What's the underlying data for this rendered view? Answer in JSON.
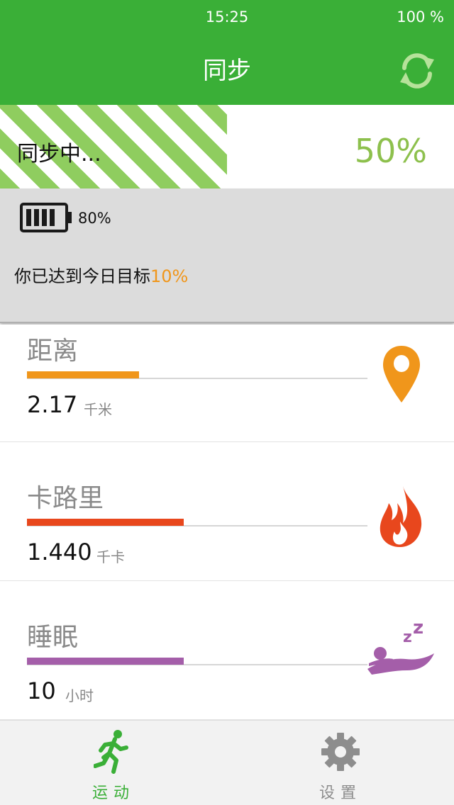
{
  "status_bar": {
    "time": "15:25",
    "battery": "100 %"
  },
  "header": {
    "title": "同步",
    "sync_icon": "sync-icon"
  },
  "sync_progress": {
    "label": "同步中...",
    "percent_text": "50%",
    "progress": 0.5
  },
  "summary": {
    "battery_percent": "80%",
    "goal_text": "你已达到今日目标",
    "goal_percent": "10%"
  },
  "metrics": [
    {
      "name": "距离",
      "value": "2.17",
      "unit": "千米",
      "progress": 0.33,
      "color": "#f0961b",
      "icon": "location-pin-icon"
    },
    {
      "name": "卡路里",
      "value": "1.440",
      "unit": "千卡",
      "progress": 0.46,
      "color": "#e8471d",
      "icon": "flame-icon"
    },
    {
      "name": "睡眠",
      "value": "10",
      "unit": "小时",
      "progress": 0.46,
      "color": "#a45ea9",
      "icon": "sleep-icon"
    }
  ],
  "tabs": [
    {
      "label": "运动",
      "icon": "running-icon",
      "active": true,
      "color": "#3aaf37"
    },
    {
      "label": "设置",
      "icon": "gear-icon",
      "active": false,
      "color": "#8d8d8d"
    }
  ]
}
